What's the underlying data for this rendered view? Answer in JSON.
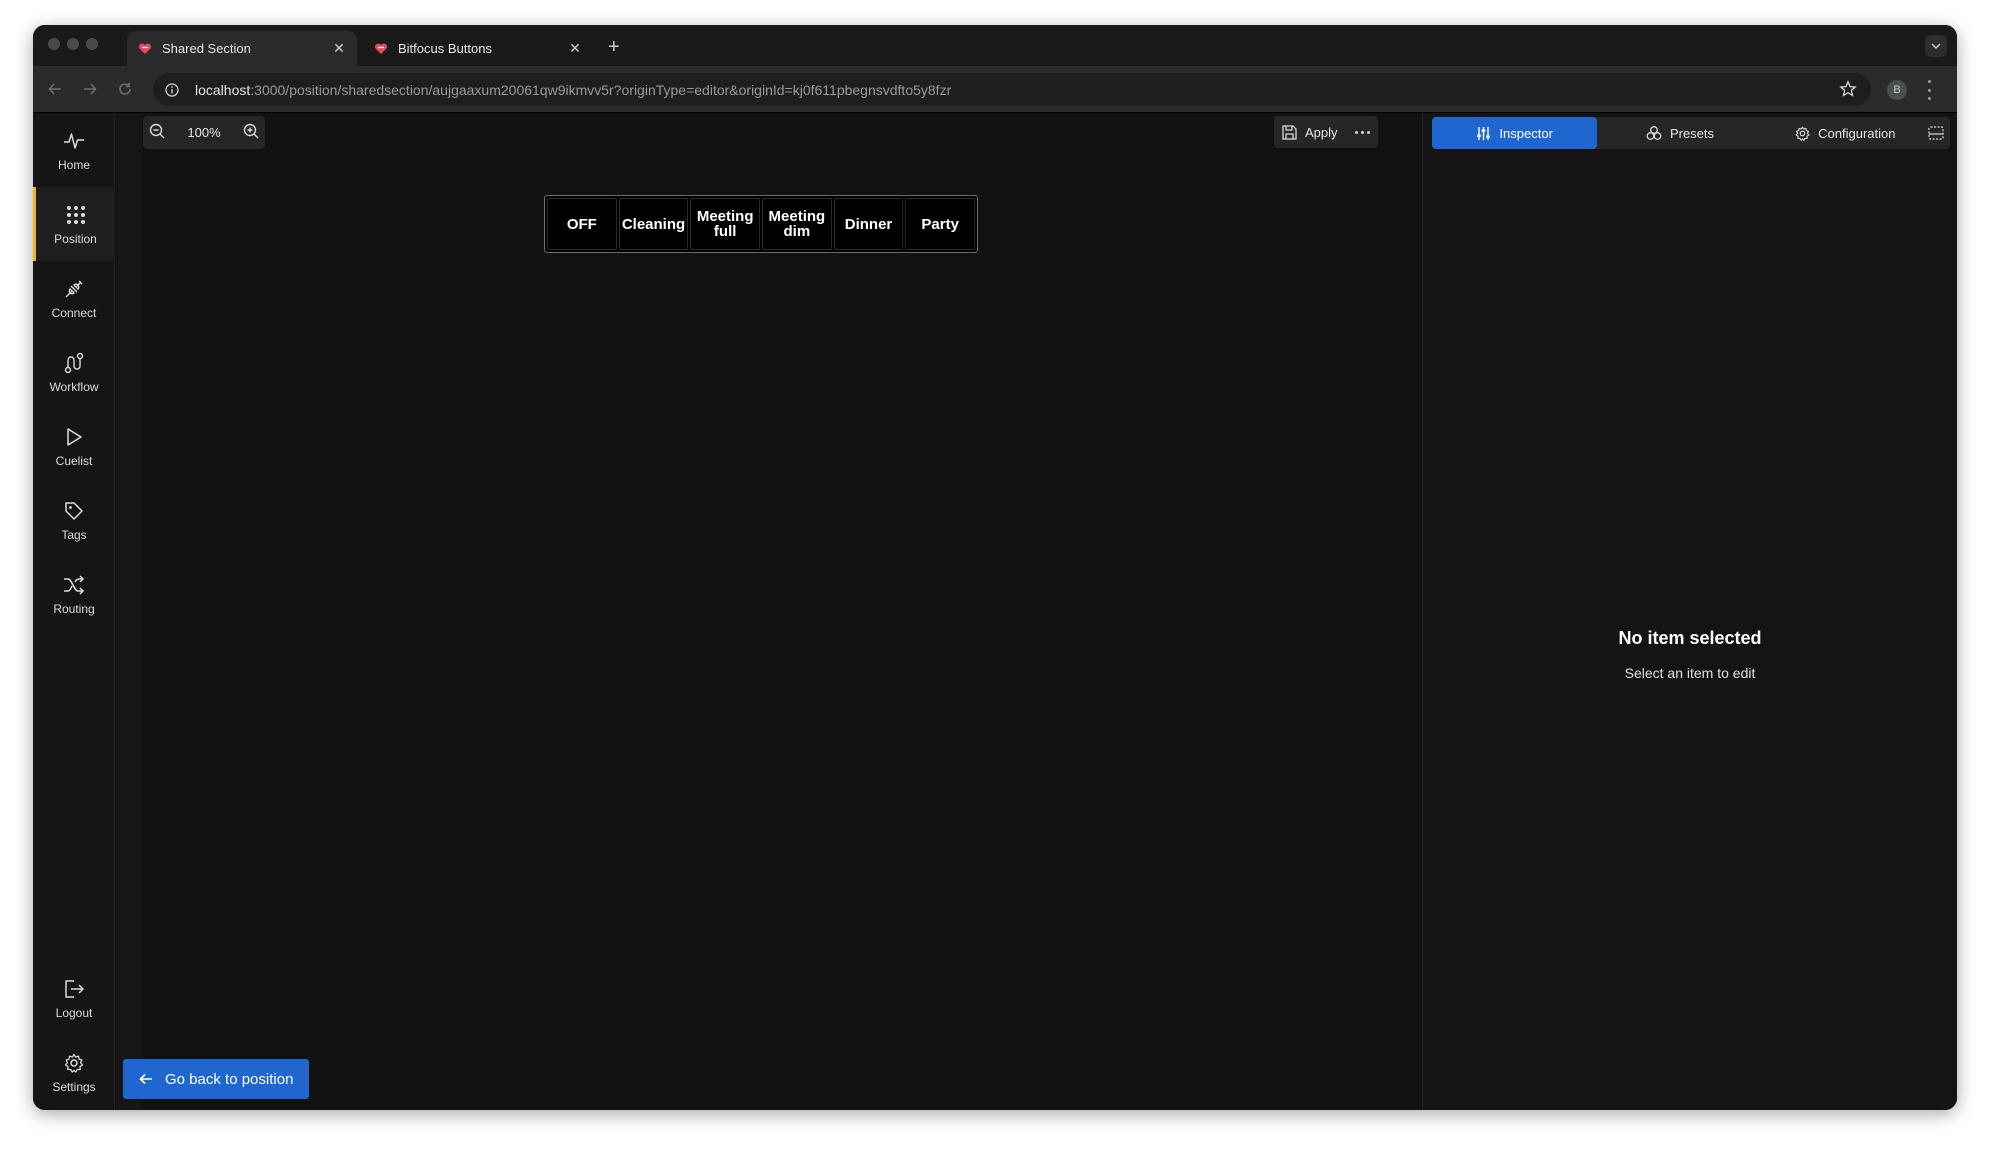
{
  "browser": {
    "tabs": [
      {
        "title": "Shared Section",
        "active": true
      },
      {
        "title": "Bitfocus Buttons",
        "active": false
      }
    ],
    "url_host": "localhost",
    "url_rest": ":3000/position/sharedsection/aujgaaxum20061qw9ikmvv5r?originType=editor&originId=kj0f611pbegnsvdfto5y8fzr",
    "profile_initial": "B"
  },
  "sidebar": {
    "items": [
      {
        "label": "Home",
        "icon": "activity-icon"
      },
      {
        "label": "Position",
        "icon": "grid-dots-icon",
        "active": true
      },
      {
        "label": "Connect",
        "icon": "plug-icon"
      },
      {
        "label": "Workflow",
        "icon": "workflow-icon"
      },
      {
        "label": "Cuelist",
        "icon": "play-icon"
      },
      {
        "label": "Tags",
        "icon": "tag-icon"
      },
      {
        "label": "Routing",
        "icon": "shuffle-icon"
      }
    ],
    "bottom": [
      {
        "label": "Logout",
        "icon": "logout-icon"
      },
      {
        "label": "Settings",
        "icon": "gear-icon"
      }
    ],
    "accent_color": "#f0b429"
  },
  "canvas": {
    "zoom": "100%",
    "apply_label": "Apply",
    "buttons": [
      "OFF",
      "Cleaning",
      "Meeting\nfull",
      "Meeting\ndim",
      "Dinner",
      "Party"
    ],
    "go_back_label": "Go back to position"
  },
  "right_panel": {
    "tabs": [
      {
        "label": "Inspector",
        "active": true
      },
      {
        "label": "Presets"
      },
      {
        "label": "Configuration"
      }
    ],
    "empty_title": "No item selected",
    "empty_subtitle": "Select an item to edit",
    "accent_color": "#1f66d1"
  }
}
